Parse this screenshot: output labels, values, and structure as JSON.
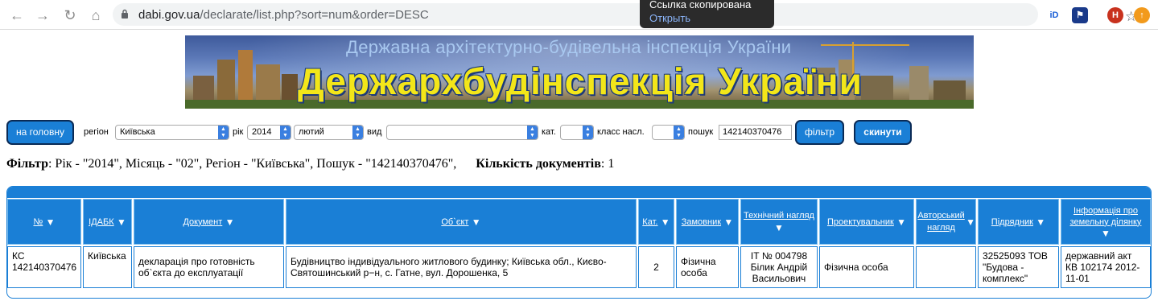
{
  "browser": {
    "url_host": "dabi.gov.ua",
    "url_path": "/declarate/list.php?sort=num&order=DESC",
    "toast_title": "Ссылка скопирована",
    "toast_action": "Открыть",
    "ext1": "iD",
    "profile_initial": "H"
  },
  "banner": {
    "subtitle": "Державна архітектурно-будівельна інспекція України",
    "title": "Держархбудінспекція України"
  },
  "filters": {
    "home_button": "на головну",
    "region_label": "регіон",
    "region_value": "Київська",
    "year_label": "рік",
    "year_value": "2014",
    "month_value": "лютий",
    "type_label": "вид",
    "type_value": "",
    "cat_label": "кат.",
    "cat_value": "",
    "class_label": "класс насл.",
    "class_value": "",
    "search_label": "пошук",
    "search_value": "142140370476",
    "filter_button": "фільтр",
    "reset_button": "скинути"
  },
  "summary": {
    "filter_label": "Фільтр",
    "filter_text": ": Рік - \"2014\", Місяць - \"02\", Регіон - \"Київська\", Пошук - \"142140370476\",",
    "count_label": "Кількість документів",
    "count_value": ": 1"
  },
  "table": {
    "headers": [
      "№",
      "ІДАБК",
      "Документ",
      "Об`єкт",
      "Кат.",
      "Замовник",
      "Технічний нагляд",
      "Проектувальник",
      "Авторський нагляд",
      "Підрядник",
      "Інформація про земельну ділянку"
    ],
    "row": {
      "num": "КС 142140370476",
      "idabk": "Київська",
      "document": "декларація про готовність об`єкта до експлуатації",
      "object": "Будівництво індивідуального житлового будинку; Київська обл., Києво-Святошинський р−н, с. Гатне, вул. Дорошенка, 5",
      "cat": "2",
      "customer": "Фізична особа",
      "tech_supervision": "ІТ № 004798 Білик Андрій Васильович",
      "designer": "Фізична особа",
      "author_supervision": "",
      "contractor": "32525093 ТОВ \"Будова - комплекс\"",
      "land_info": "державний акт КВ 102174 2012-11-01"
    }
  }
}
